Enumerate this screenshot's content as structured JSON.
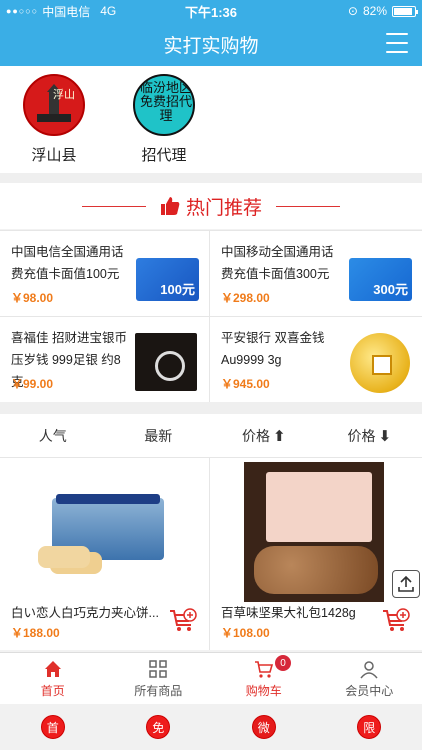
{
  "status": {
    "carrier": "中国电信",
    "network": "4G",
    "time": "下午1:36",
    "battery": "82%"
  },
  "header": {
    "title": "实打实购物"
  },
  "categories": [
    {
      "label": "浮山县",
      "logo_text": "浮山"
    },
    {
      "label": "招代理",
      "logo_text": "临汾地区免费招代理"
    }
  ],
  "hot": {
    "title": "热门推荐"
  },
  "recommend": [
    {
      "name": "中国电信全国通用话费充值卡面值100元",
      "price": "￥98.00",
      "card_value": "100元"
    },
    {
      "name": "中国移动全国通用话费充值卡面值300元",
      "price": "￥298.00",
      "card_value": "300元"
    },
    {
      "name": "喜福佳 招财进宝银币压岁钱 999足银 约8克",
      "price": "￥99.00"
    },
    {
      "name": "平安银行 双喜金钱 Au9999 3g",
      "price": "￥945.00"
    }
  ],
  "sort": {
    "popular": "人气",
    "newest": "最新",
    "price_up": "价格",
    "price_down": "价格"
  },
  "products": [
    {
      "name": "白い恋人白巧克力夹心饼...",
      "price": "￥188.00"
    },
    {
      "name": "百草味坚果大礼包1428g",
      "price": "￥108.00"
    }
  ],
  "tabs": {
    "home": "首页",
    "all": "所有商品",
    "cart": "购物车",
    "cart_count": "0",
    "member": "会员中心"
  },
  "quick": [
    "首",
    "免",
    "微",
    "限"
  ],
  "colors": {
    "brand": "#3aaee6",
    "accent": "#e0302b",
    "price": "#f07b1a"
  }
}
